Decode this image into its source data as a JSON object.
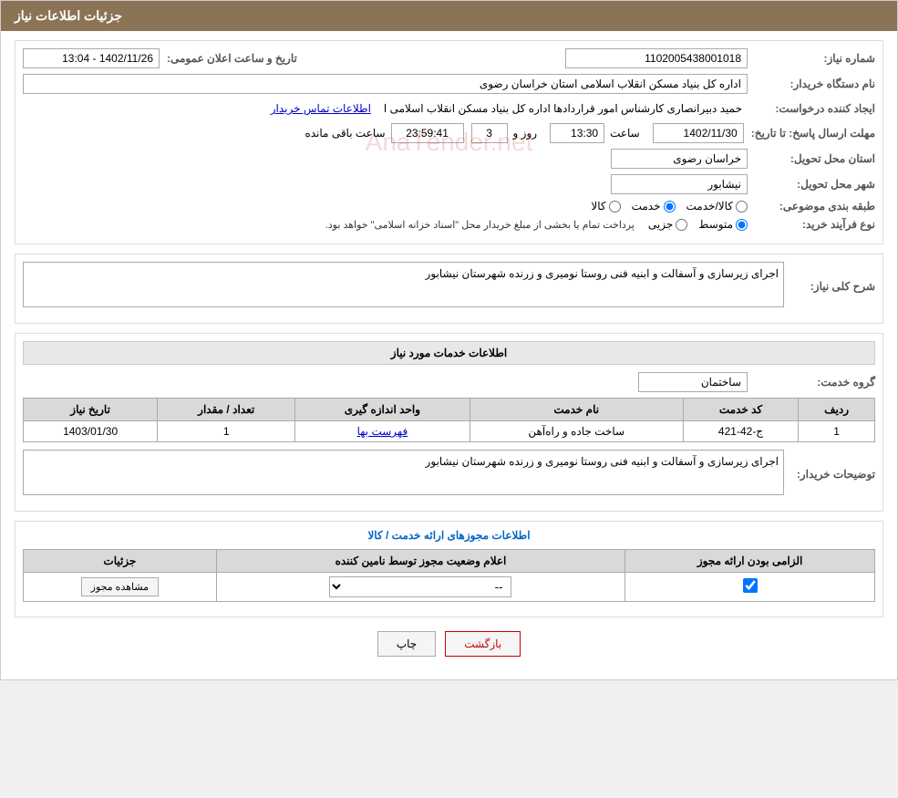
{
  "header": {
    "title": "جزئیات اطلاعات نیاز"
  },
  "fields": {
    "tender_number_label": "شماره نیاز:",
    "tender_number_value": "1102005438001018",
    "announcement_date_label": "تاریخ و ساعت اعلان عمومی:",
    "announcement_date_value": "1402/11/26 - 13:04",
    "buyer_org_label": "نام دستگاه خریدار:",
    "buyer_org_value": "اداره کل بنیاد مسکن انقلاب اسلامی استان خراسان رضوی",
    "requester_label": "ایجاد کننده درخواست:",
    "requester_value": "حمید دبیرانصاری کارشناس امور قراردادها اداره کل بنیاد مسکن انقلاب اسلامی ا",
    "requester_link": "اطلاعات تماس خریدار",
    "response_deadline_label": "مهلت ارسال پاسخ: تا تاریخ:",
    "response_date": "1402/11/30",
    "response_time_label": "ساعت",
    "response_time": "13:30",
    "response_days_label": "روز و",
    "response_days": "3",
    "response_remaining_label": "ساعت باقی مانده",
    "response_remaining": "23:59:41",
    "province_label": "استان محل تحویل:",
    "province_value": "خراسان رضوی",
    "city_label": "شهر محل تحویل:",
    "city_value": "نیشابور",
    "category_label": "طبقه بندی موضوعی:",
    "category_options": [
      "کالا",
      "خدمت",
      "کالا/خدمت"
    ],
    "category_selected": "خدمت",
    "purchase_type_label": "نوع فرآیند خرید:",
    "purchase_options": [
      "جزیی",
      "متوسط"
    ],
    "purchase_selected": "متوسط",
    "purchase_notice": "پرداخت تمام یا بخشی از مبلغ خریدار محل \"اسناد خزانه اسلامی\" خواهد بود.",
    "description_label": "شرح کلی نیاز:",
    "description_value": "اجرای زیرسازی و آسفالت و ابنیه فنی روستا نومیری و زرنده شهرستان نیشابور",
    "services_section": "اطلاعات خدمات مورد نیاز",
    "service_group_label": "گروه خدمت:",
    "service_group_value": "ساختمان",
    "table": {
      "headers": [
        "ردیف",
        "کد خدمت",
        "نام خدمت",
        "واحد اندازه گیری",
        "تعداد / مقدار",
        "تاریخ نیاز"
      ],
      "rows": [
        {
          "row": "1",
          "code": "ج-42-421",
          "name": "ساخت جاده و راه‌آهن",
          "unit": "فهرست بها",
          "quantity": "1",
          "date": "1403/01/30"
        }
      ]
    },
    "buyer_desc_label": "توضیحات خریدار:",
    "buyer_desc_value": "اجرای زیرسازی و آسفالت و ابنیه فنی روستا نومیری و زرنده شهرستان نیشابور",
    "license_section": "اطلاعات مجوزهای ارائه خدمت / کالا",
    "license_table": {
      "headers": [
        "الزامی بودن ارائه مجوز",
        "اعلام وضعیت مجوز توسط نامین کننده",
        "جزئیات"
      ],
      "rows": [
        {
          "required": true,
          "status": "--",
          "details_btn": "مشاهده مجوز"
        }
      ]
    }
  },
  "buttons": {
    "print": "چاپ",
    "back": "بازگشت"
  }
}
